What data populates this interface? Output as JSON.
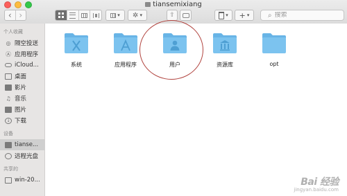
{
  "window": {
    "title": "tiansemixiang"
  },
  "toolbar": {
    "back_icon": "‹",
    "forward_icon": "›",
    "gear_icon": "✲",
    "dropdown_icon": "▾",
    "add_icon": "+",
    "share_icon": "⇧"
  },
  "search": {
    "placeholder": "搜索",
    "icon": "⌕"
  },
  "sidebar": {
    "favorites_header": "个人收藏",
    "favorites": [
      {
        "label": "隔空投送",
        "icon": "airdrop-icon"
      },
      {
        "label": "应用程序",
        "icon": "applications-icon"
      },
      {
        "label": "iCloud...",
        "icon": "icloud-icon"
      },
      {
        "label": "桌面",
        "icon": "desktop-icon"
      },
      {
        "label": "影片",
        "icon": "movies-icon"
      },
      {
        "label": "音乐",
        "icon": "music-icon"
      },
      {
        "label": "图片",
        "icon": "pictures-icon"
      },
      {
        "label": "下载",
        "icon": "downloads-icon"
      }
    ],
    "devices_header": "设备",
    "devices": [
      {
        "label": "tianse...",
        "icon": "home-icon",
        "selected": true
      },
      {
        "label": "远程光盘",
        "icon": "remote-disc-icon"
      }
    ],
    "shared_header": "共享的",
    "shared": [
      {
        "label": "win-20...",
        "icon": "computer-icon"
      }
    ]
  },
  "folders": [
    {
      "label": "系统",
      "emblem": "system-icon"
    },
    {
      "label": "应用程序",
      "emblem": "applications-icon"
    },
    {
      "label": "用户",
      "emblem": "user-icon"
    },
    {
      "label": "资源库",
      "emblem": "library-icon"
    },
    {
      "label": "opt",
      "emblem": ""
    }
  ],
  "watermark": {
    "main": "Bai 经验",
    "sub": "jingyan.baidu.com"
  },
  "colors": {
    "folder_body": "#7cc3ef",
    "folder_tab": "#68b4e6",
    "folder_emblem": "#4e9fd3",
    "annotation_circle": "#b0413c",
    "close": "#fc605c",
    "minimize": "#fdbc40",
    "zoom": "#34c84a"
  }
}
